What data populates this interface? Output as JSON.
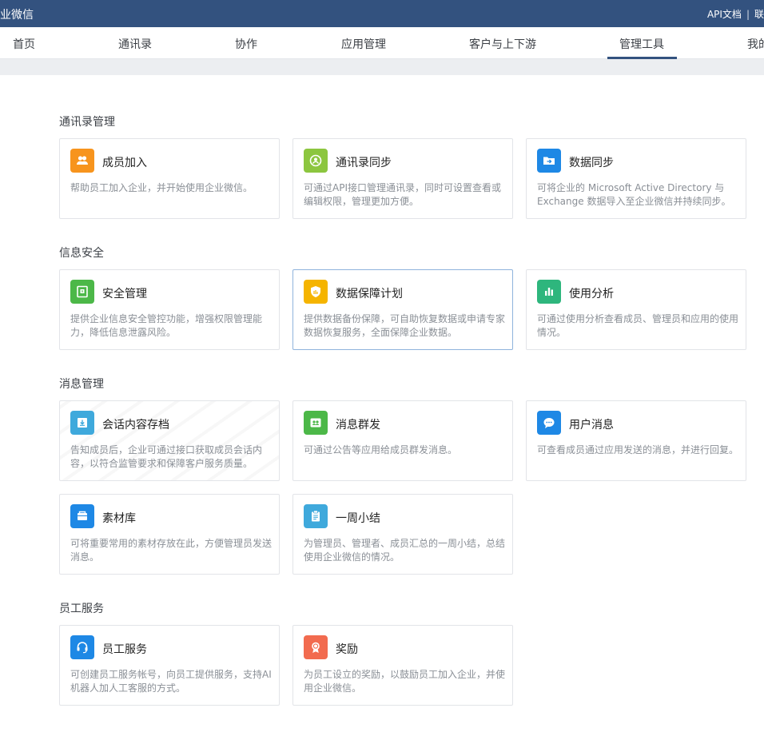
{
  "header": {
    "brand": "企业微信",
    "links": {
      "api_docs": "API文档",
      "separator": "|",
      "trailing": "联"
    }
  },
  "nav": {
    "tabs": [
      "首页",
      "通讯录",
      "协作",
      "应用管理",
      "客户与上下游",
      "管理工具",
      "我的企业"
    ],
    "active": "管理工具"
  },
  "sections": [
    {
      "title": "通讯录管理",
      "cards": [
        {
          "title": "成员加入",
          "desc": "帮助员工加入企业，并开始使用企业微信。",
          "icon": "members-icon",
          "color": "#f7941d"
        },
        {
          "title": "通讯录同步",
          "desc": "可通过API接口管理通讯录，同时可设置查看或编辑权限，管理更加方便。",
          "icon": "contact-sync-icon",
          "color": "#8cc63f"
        },
        {
          "title": "数据同步",
          "desc": "可将企业的 Microsoft Active Directory 与 Exchange 数据导入至企业微信并持续同步。",
          "icon": "folder-sync-icon",
          "color": "#1e88e5"
        }
      ]
    },
    {
      "title": "信息安全",
      "cards": [
        {
          "title": "安全管理",
          "desc": "提供企业信息安全管控功能，增强权限管理能力，降低信息泄露风险。",
          "icon": "safe-icon",
          "color": "#4cb848"
        },
        {
          "title": "数据保障计划",
          "desc": "提供数据备份保障，可自助恢复数据或申请专家数据恢复服务，全面保障企业数据。",
          "icon": "shield-icon",
          "color": "#f5b400"
        },
        {
          "title": "使用分析",
          "desc": "可通过使用分析查看成员、管理员和应用的使用情况。",
          "icon": "bar-chart-icon",
          "color": "#2eb67d"
        }
      ]
    },
    {
      "title": "消息管理",
      "cards": [
        {
          "title": "会话内容存档",
          "desc": "告知成员后，企业可通过接口获取成员会话内容，以符合监管要求和保障客户服务质量。",
          "icon": "archive-icon",
          "color": "#3fa9dc"
        },
        {
          "title": "消息群发",
          "desc": "可通过公告等应用给成员群发消息。",
          "icon": "group-message-icon",
          "color": "#4cb848"
        },
        {
          "title": "用户消息",
          "desc": "可查看成员通过应用发送的消息，并进行回复。",
          "icon": "chat-bubble-icon",
          "color": "#1e88e5"
        },
        {
          "title": "素材库",
          "desc": "可将重要常用的素材存放在此，方便管理员发送消息。",
          "icon": "materials-icon",
          "color": "#1e88e5"
        },
        {
          "title": "一周小结",
          "desc": "为管理员、管理者、成员汇总的一周小结，总结使用企业微信的情况。",
          "icon": "clipboard-icon",
          "color": "#3fa9dc"
        }
      ]
    },
    {
      "title": "员工服务",
      "cards": [
        {
          "title": "员工服务",
          "desc": "可创建员工服务帐号，向员工提供服务，支持AI机器人加人工客服的方式。",
          "icon": "headset-icon",
          "color": "#1e88e5"
        },
        {
          "title": "奖励",
          "desc": "为员工设立的奖励，以鼓励员工加入企业，并使用企业微信。",
          "icon": "award-icon",
          "color": "#f26b4f"
        }
      ]
    }
  ]
}
